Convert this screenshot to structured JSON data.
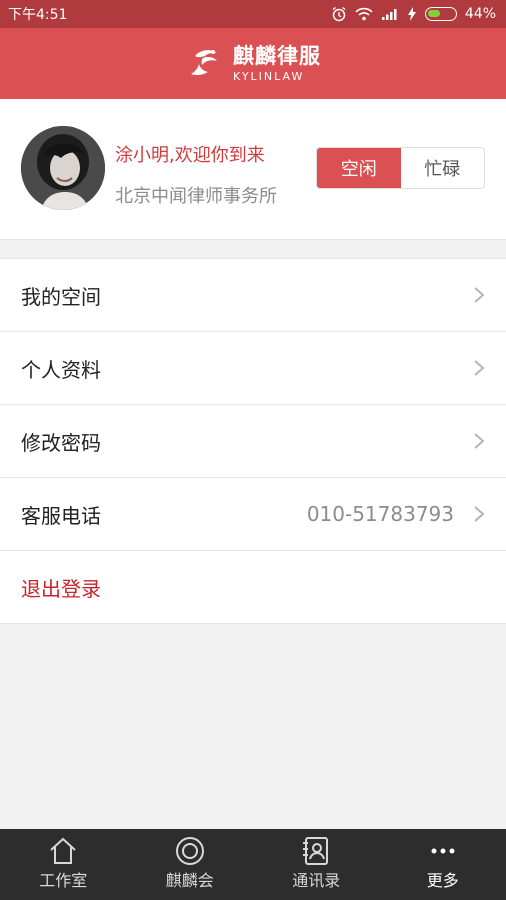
{
  "status_bar": {
    "time": "下午4:51",
    "battery_percent": "44%",
    "battery_level": 0.44,
    "icons": [
      "alarm-icon",
      "wifi-icon",
      "signal-icon",
      "charging-icon",
      "battery-icon"
    ]
  },
  "header": {
    "logo_cn": "麒麟律服",
    "logo_en": "KYLINLAW"
  },
  "profile": {
    "greeting": "涂小明,欢迎你到来",
    "firm": "北京中闻律师事务所",
    "status_options": [
      {
        "label": "空闲",
        "active": true
      },
      {
        "label": "忙碌",
        "active": false
      }
    ]
  },
  "menu": {
    "items": [
      {
        "label": "我的空间",
        "value": ""
      },
      {
        "label": "个人资料",
        "value": ""
      },
      {
        "label": "修改密码",
        "value": ""
      },
      {
        "label": "客服电话",
        "value": "010-51783793"
      }
    ],
    "logout": "退出登录"
  },
  "tabbar": {
    "tabs": [
      {
        "label": "工作室",
        "icon": "home-icon"
      },
      {
        "label": "麒麟会",
        "icon": "circle-icon"
      },
      {
        "label": "通讯录",
        "icon": "contacts-icon"
      },
      {
        "label": "更多",
        "icon": "more-icon"
      }
    ]
  },
  "colors": {
    "brand": "#db5053",
    "status_bar": "#b03a3d",
    "logout": "#c8242a",
    "tabbar": "#2d2d2d"
  }
}
